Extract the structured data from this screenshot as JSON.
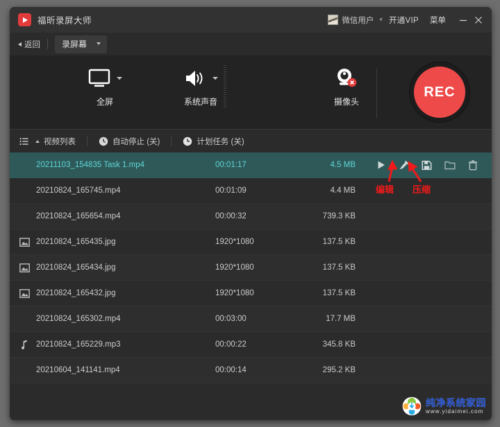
{
  "window": {
    "app_icon": "video-play-icon",
    "title": "福昕录屏大师",
    "user": {
      "avatar": "user-avatar",
      "name": "微信用户",
      "chevron": "chevron-down-icon"
    },
    "vip_link": "开通VIP",
    "menu_label": "菜单",
    "minimize": "minimize-icon",
    "close": "close-icon"
  },
  "toolbar": {
    "back_label": "返回",
    "back_icon": "back-arrow-icon",
    "mode_label": "录屏幕",
    "mode_caret": "chevron-down-icon"
  },
  "capture": {
    "items": [
      {
        "icon": "monitor-icon",
        "label": "全屏",
        "has_dropdown": true
      },
      {
        "icon": "speaker-icon",
        "label": "系统声音",
        "has_dropdown": true
      },
      {
        "icon": "webcam-icon",
        "label": "摄像头",
        "has_dropdown": false,
        "badge": "disabled-x-badge"
      }
    ],
    "rec_label": "REC",
    "rec_color": "#ef4a4a"
  },
  "list_toolbar": {
    "items": [
      {
        "icon": "list-icon",
        "label": "视频列表",
        "caret": "caret-up-icon"
      },
      {
        "icon": "clock-icon",
        "label": "自动停止 (关)"
      },
      {
        "icon": "clock-filled-icon",
        "label": "计划任务 (关)"
      }
    ]
  },
  "file_list": {
    "selected_row_color": "#2f5959",
    "selected_text_color": "#5fd6d6",
    "rows": [
      {
        "icon": "",
        "name": "20211103_154835 Task 1.mp4",
        "duration": "00:01:17",
        "size": "4.5 MB",
        "selected": true
      },
      {
        "icon": "",
        "name": "20210824_165745.mp4",
        "duration": "00:01:09",
        "size": "4.4 MB",
        "selected": false
      },
      {
        "icon": "",
        "name": "20210824_165654.mp4",
        "duration": "00:00:32",
        "size": "739.3 KB",
        "selected": false
      },
      {
        "icon": "image-icon",
        "name": "20210824_165435.jpg",
        "duration": "1920*1080",
        "size": "137.5 KB",
        "selected": false
      },
      {
        "icon": "image-icon",
        "name": "20210824_165434.jpg",
        "duration": "1920*1080",
        "size": "137.5 KB",
        "selected": false
      },
      {
        "icon": "image-icon",
        "name": "20210824_165432.jpg",
        "duration": "1920*1080",
        "size": "137.5 KB",
        "selected": false
      },
      {
        "icon": "",
        "name": "20210824_165302.mp4",
        "duration": "00:03:00",
        "size": "17.7 MB",
        "selected": false
      },
      {
        "icon": "music-note-icon",
        "name": "20210824_165229.mp3",
        "duration": "00:00:22",
        "size": "345.8 KB",
        "selected": false
      },
      {
        "icon": "",
        "name": "20210604_141141.mp4",
        "duration": "00:00:14",
        "size": "295.2 KB",
        "selected": false
      }
    ],
    "actions": [
      "play-icon",
      "edit-icon",
      "compress-icon",
      "folder-icon",
      "delete-icon"
    ]
  },
  "annotations": {
    "color": "#f01a1a",
    "labels": [
      {
        "text": "编辑",
        "target": "edit-icon"
      },
      {
        "text": "压缩",
        "target": "compress-icon"
      }
    ]
  },
  "watermark": {
    "logo": "yidaimei-logo",
    "main": "纯净系统家园",
    "sub": "www.yidaimei.com"
  }
}
